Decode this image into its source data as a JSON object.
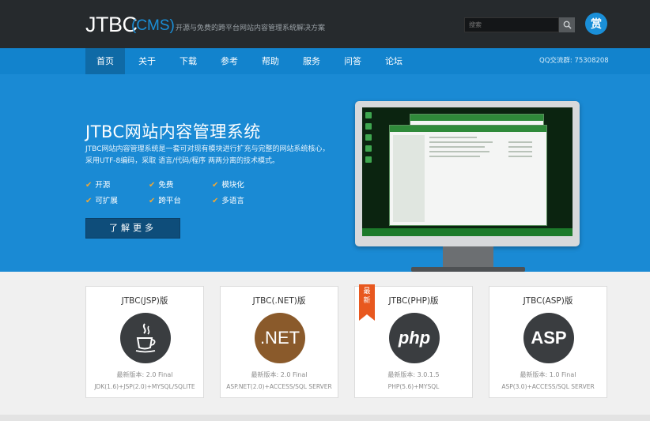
{
  "header": {
    "logo_main": "JTBC",
    "logo_cms": "(CMS)",
    "tagline": "开源与免费的跨平台网站内容管理系统解决方案",
    "search_placeholder": "搜索",
    "avatar_text": "赏"
  },
  "nav": {
    "items": [
      "首页",
      "关于",
      "下载",
      "参考",
      "帮助",
      "服务",
      "问答",
      "论坛"
    ],
    "active_index": 0,
    "qq_text": "QQ交流群: 75308208"
  },
  "hero": {
    "title": "JTBC网站内容管理系统",
    "desc_line1": "JTBC网站内容管理系统是一套可对现有模块进行扩充与完整的网站系统核心，",
    "desc_line2": "采用UTF-8编码，采取 语言/代码/程序 两两分离的技术模式。",
    "features": [
      "开源",
      "免费",
      "模块化",
      "可扩展",
      "跨平台",
      "多语言"
    ],
    "more_button": "了解更多"
  },
  "products": [
    {
      "title": "JTBC(JSP)版",
      "logo_text": "",
      "logo_color": "#3a3d40",
      "icon": "java-icon",
      "version": "最新版本: 2.0 Final",
      "requirements": "JDK(1.6)+JSP(2.0)+MYSQL/SQLITE"
    },
    {
      "title": "JTBC(.NET)版",
      "logo_text": ".NET",
      "logo_color": "#8a5a2b",
      "icon": "dotnet-icon",
      "version": "最新版本: 2.0 Final",
      "requirements": "ASP.NET(2.0)+ACCESS/SQL SERVER"
    },
    {
      "title": "JTBC(PHP)版",
      "logo_text": "php",
      "logo_color": "#3a3d40",
      "icon": "php-icon",
      "version": "最新版本: 3.0.1.5",
      "requirements": "PHP(5.6)+MYSQL"
    },
    {
      "title": "JTBC(ASP)版",
      "logo_text": "ASP",
      "logo_color": "#3a3d40",
      "icon": "asp-icon",
      "version": "最新版本: 1.0 Final",
      "requirements": "ASP(3.0)+ACCESS/SQL SERVER"
    }
  ],
  "ribbon_text": "最新",
  "colors": {
    "header_bg": "#262a2d",
    "nav_bg": "#1283cd",
    "hero_bg": "#1a8ad4",
    "accent": "#1a8fd8",
    "check": "#f0a834",
    "ribbon": "#e8581f"
  }
}
